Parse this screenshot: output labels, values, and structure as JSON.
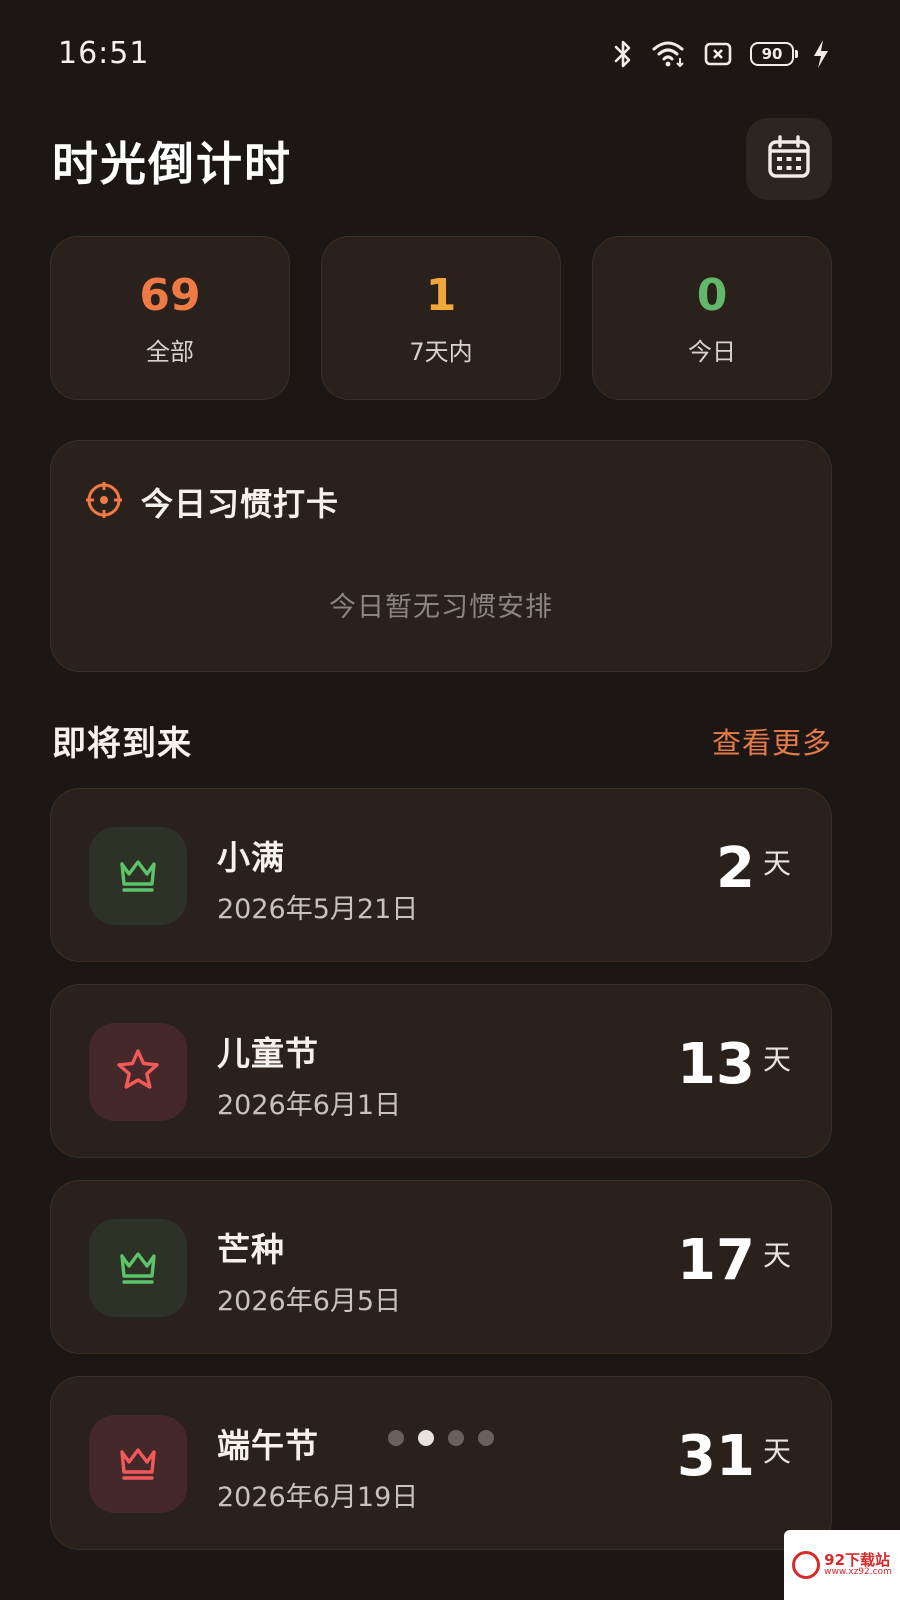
{
  "status_bar": {
    "time": "16:51",
    "battery": "90",
    "icons": [
      "bluetooth-icon",
      "wifi-icon",
      "sim-icon",
      "battery-icon",
      "charging-icon"
    ]
  },
  "header": {
    "title": "时光倒计时",
    "calendar_icon": "calendar-icon"
  },
  "stats": [
    {
      "value": "69",
      "label": "全部",
      "color": "#f07a45"
    },
    {
      "value": "1",
      "label": "7天内",
      "color": "#f2a73c"
    },
    {
      "value": "0",
      "label": "今日",
      "color": "#62b86a"
    }
  ],
  "habit": {
    "title": "今日习惯打卡",
    "empty_text": "今日暂无习惯安排",
    "icon": "target-icon",
    "icon_color": "#f07a45"
  },
  "upcoming": {
    "title": "即将到来",
    "see_more": "查看更多",
    "events": [
      {
        "name": "小满",
        "date": "2026年5月21日",
        "days": "2",
        "unit": "天",
        "icon": "crown-icon",
        "icon_color": "#5cc46a",
        "tone": "green"
      },
      {
        "name": "儿童节",
        "date": "2026年6月1日",
        "days": "13",
        "unit": "天",
        "icon": "star-icon",
        "icon_color": "#f25a5a",
        "tone": "red"
      },
      {
        "name": "芒种",
        "date": "2026年6月5日",
        "days": "17",
        "unit": "天",
        "icon": "crown-icon",
        "icon_color": "#5cc46a",
        "tone": "green"
      },
      {
        "name": "端午节",
        "date": "2026年6月19日",
        "days": "31",
        "unit": "天",
        "icon": "crown-icon",
        "icon_color": "#f25a5a",
        "tone": "red"
      }
    ]
  },
  "pager": {
    "total": 4,
    "active": 2
  },
  "watermark": {
    "main": "92下载站",
    "sub": "www.xz92.com"
  }
}
